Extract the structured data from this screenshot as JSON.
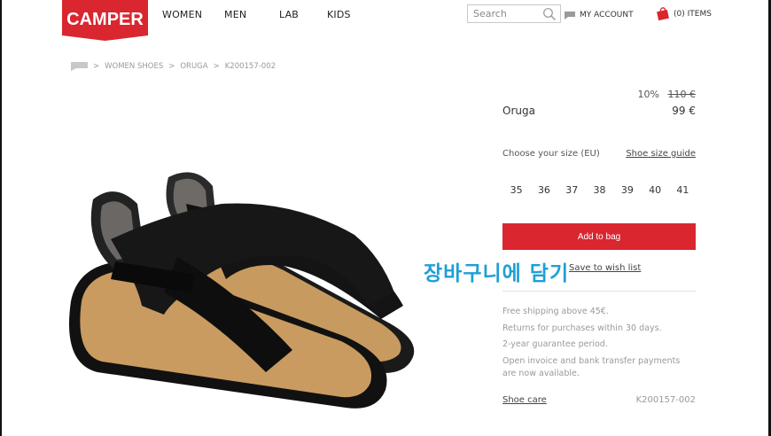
{
  "header": {
    "logo_text": "CAMPER",
    "nav": [
      "WOMEN",
      "MEN",
      "LAB",
      "KIDS"
    ],
    "search_placeholder": "Search",
    "account_label": "MY ACCOUNT",
    "bag_label": "(0) ITEMS"
  },
  "breadcrumb": {
    "items": [
      "WOMEN  SHOES",
      "ORUGA",
      "K200157-002"
    ],
    "separator": ">"
  },
  "product": {
    "discount": "10%",
    "old_price": "110  €",
    "name": "Oruga",
    "price": "99  €",
    "size_label": "Choose your size (EU)",
    "size_guide": "Shoe size guide",
    "sizes": [
      "35",
      "36",
      "37",
      "38",
      "39",
      "40",
      "41"
    ],
    "add_to_bag": "Add to bag",
    "wish_list": "Save to wish list",
    "overlay_text": "장바구니에 담기",
    "info": [
      "Free shipping above 45€.",
      "Returns for purchases within 30 days.",
      "2-year guarantee period.",
      "Open invoice and bank transfer payments are now available."
    ],
    "shoe_care": "Shoe care",
    "code": "K200157-002"
  },
  "colors": {
    "brand_red": "#d9262f",
    "overlay_blue": "#1e9fd6"
  }
}
